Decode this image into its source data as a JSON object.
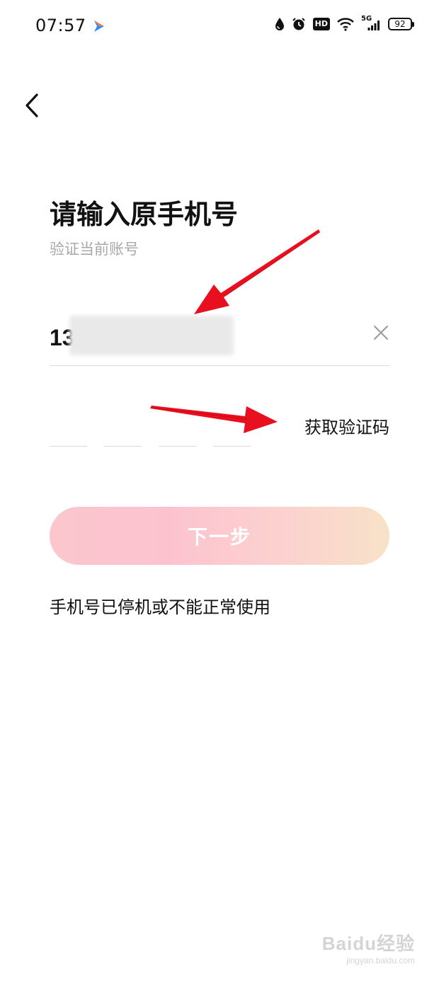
{
  "status_bar": {
    "time": "07:57",
    "network": "5G",
    "hd": "HD",
    "battery": "92",
    "icons": [
      "app-arrow-icon",
      "water-drop-icon",
      "alarm-icon",
      "hd-icon",
      "wifi-icon",
      "signal-5g-icon",
      "battery-icon"
    ]
  },
  "header": {
    "back_icon": "chevron-left-icon"
  },
  "page": {
    "title": "请输入原手机号",
    "subtitle": "验证当前账号"
  },
  "phone_field": {
    "value": "13",
    "clear_icon": "close-icon"
  },
  "code_field": {
    "get_code_label": "获取验证码",
    "boxes": 4
  },
  "actions": {
    "next_label": "下一步",
    "stopped_link": "手机号已停机或不能正常使用"
  },
  "colors": {
    "annotation_arrow": "#e8101e",
    "button_gradient_start": "#fbc6cc",
    "button_gradient_end": "#f7e2c8",
    "subtitle": "#a8a8a8"
  },
  "watermark": {
    "main": "Baidu经验",
    "sub": "jingyan.baidu.com"
  }
}
